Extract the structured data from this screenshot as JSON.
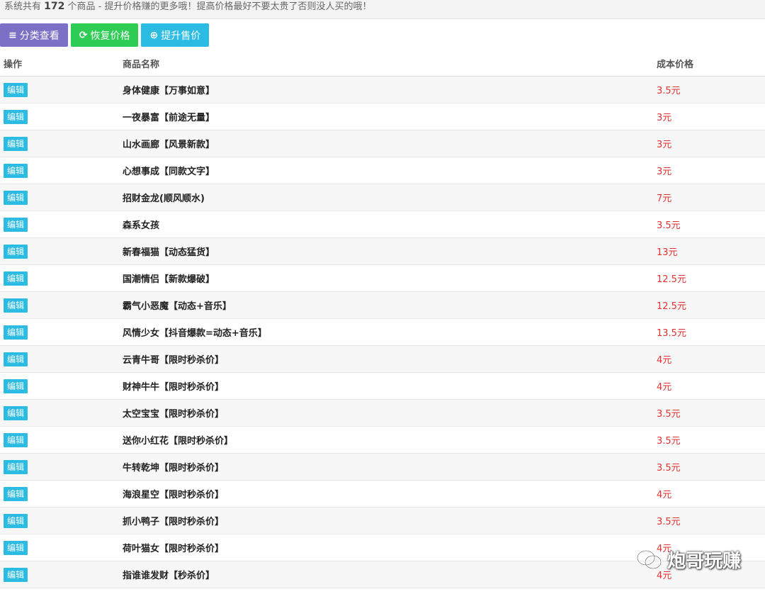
{
  "notice": {
    "prefix": "系统共有",
    "count": "172",
    "suffix": "个商品 - 提升价格赚的更多哦！提高价格最好不要太贵了否则没人买的哦！"
  },
  "toolbar": {
    "category_label": "分类查看",
    "restore_label": "恢复价格",
    "raise_label": "提升售价"
  },
  "table": {
    "headers": {
      "op": "操作",
      "name": "商品名称",
      "price": "成本价格"
    },
    "edit_label": "编辑",
    "rows": [
      {
        "name": "身体健康【万事如意】",
        "price": "3.5元"
      },
      {
        "name": "一夜暴富【前途无量】",
        "price": "3元"
      },
      {
        "name": "山水画廊【风景新款】",
        "price": "3元"
      },
      {
        "name": "心想事成【同款文字】",
        "price": "3元"
      },
      {
        "name": "招财金龙(顺风顺水)",
        "price": "7元"
      },
      {
        "name": "森系女孩",
        "price": "3.5元"
      },
      {
        "name": "新春福猫【动态猛货】",
        "price": "13元"
      },
      {
        "name": "国潮情侣【新款爆破】",
        "price": "12.5元"
      },
      {
        "name": "霸气小恶魔【动态+音乐】",
        "price": "12.5元"
      },
      {
        "name": "风情少女【抖音爆款=动态+音乐】",
        "price": "13.5元"
      },
      {
        "name": "云青牛哥【限时秒杀价】",
        "price": "4元"
      },
      {
        "name": "财神牛牛【限时秒杀价】",
        "price": "4元"
      },
      {
        "name": "太空宝宝【限时秒杀价】",
        "price": "3.5元"
      },
      {
        "name": "送你小红花【限时秒杀价】",
        "price": "3.5元"
      },
      {
        "name": "牛转乾坤【限时秒杀价】",
        "price": "3.5元"
      },
      {
        "name": "海浪星空【限时秒杀价】",
        "price": "4元"
      },
      {
        "name": "抓小鸭子【限时秒杀价】",
        "price": "3.5元"
      },
      {
        "name": "荷叶猫女【限时秒杀价】",
        "price": "4元"
      },
      {
        "name": "指谁谁发财【秒杀价】",
        "price": "4元"
      }
    ]
  },
  "watermark": {
    "text": "炮哥玩赚"
  },
  "colors": {
    "purple": "#7b6fc6",
    "green": "#2ecc55",
    "cyan": "#2bbbe3",
    "price_red": "#e43030"
  },
  "icons": {
    "category": "list-icon",
    "restore": "refresh-icon",
    "raise": "plus-circle-icon",
    "watermark": "wechat-icon"
  }
}
